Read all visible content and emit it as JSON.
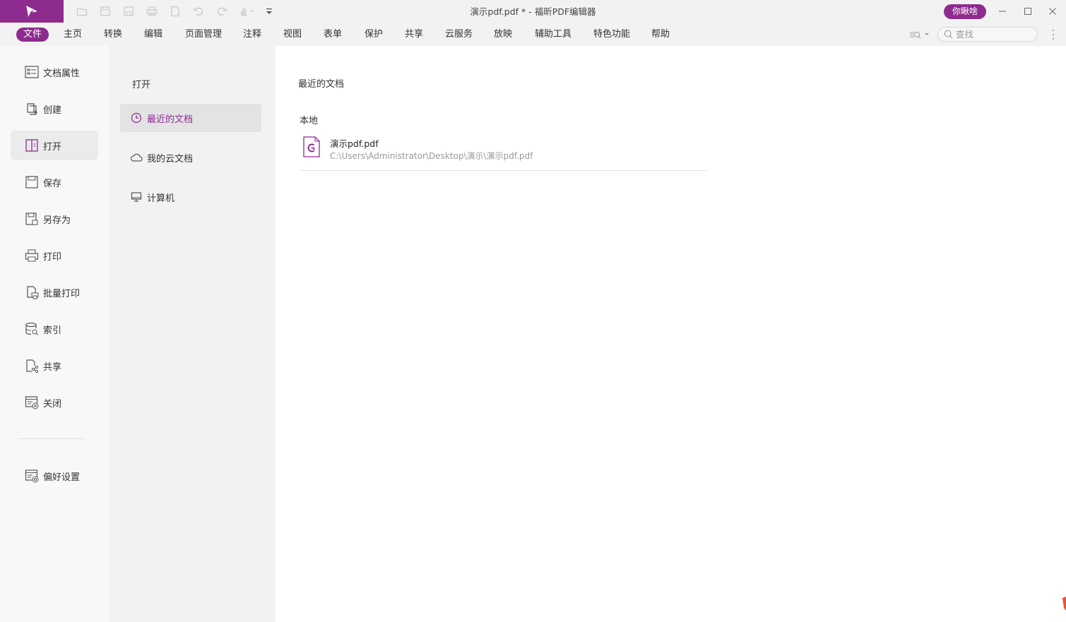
{
  "window": {
    "title": "演示pdf.pdf * - 福昕PDF编辑器",
    "user_button": "你瞅啥",
    "accent_color": "#8e2b8e"
  },
  "quick_access": [
    "open-icon",
    "save-icon",
    "save-as-icon",
    "print-icon",
    "new-doc-icon",
    "undo-icon",
    "redo-icon",
    "hand-tool-icon",
    "customize-icon"
  ],
  "menu": {
    "items": [
      "文件",
      "主页",
      "转换",
      "编辑",
      "页面管理",
      "注释",
      "视图",
      "表单",
      "保护",
      "共享",
      "云服务",
      "放映",
      "辅助工具",
      "特色功能",
      "帮助"
    ],
    "active": "文件",
    "search_placeholder": "查找"
  },
  "left_nav": {
    "items": [
      "文档属性",
      "创建",
      "打开",
      "保存",
      "另存为",
      "打印",
      "批量打印",
      "索引",
      "共享",
      "关闭"
    ],
    "preferences": "偏好设置",
    "active": "打开"
  },
  "open_panel": {
    "heading": "打开",
    "items": [
      "最近的文档",
      "我的云文档",
      "计算机"
    ],
    "active": "最近的文档"
  },
  "recent": {
    "title": "最近的文档",
    "section": "本地",
    "files": [
      {
        "name": "演示pdf.pdf",
        "path": "C:\\Users\\Administrator\\Desktop\\演示\\演示pdf.pdf"
      }
    ]
  }
}
